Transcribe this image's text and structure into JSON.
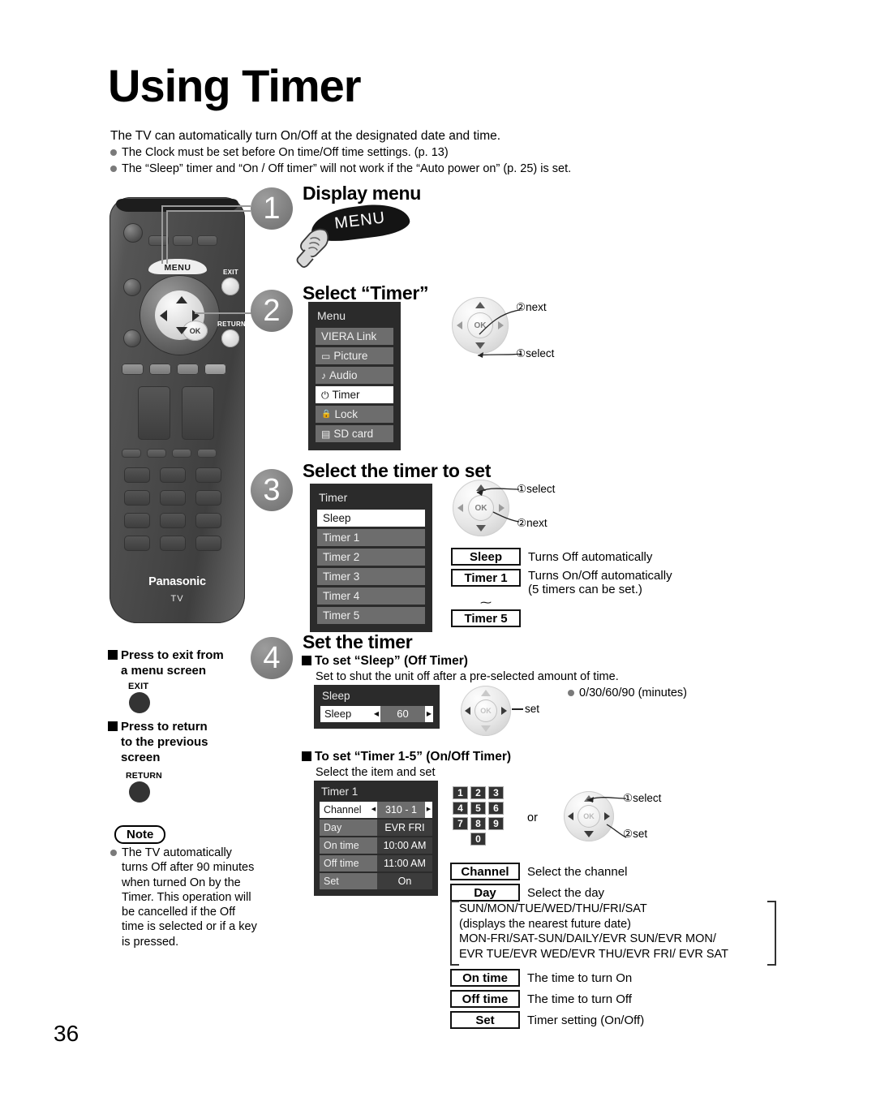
{
  "page": {
    "number": "36",
    "title": "Using Timer"
  },
  "intro": {
    "lead": "The TV can automatically turn On/Off at the designated date and time.",
    "bullets": [
      "The Clock must be set before On time/Off time settings. (p. 13)",
      "The “Sleep” timer and “On / Off timer” will not work if the “Auto power on” (p. 25) is set."
    ]
  },
  "remote": {
    "menu_key_label": "MENU",
    "exit_key_label": "EXIT",
    "return_key_label": "RETURN",
    "ok_label": "OK",
    "brand": "Panasonic",
    "brand_sub": "TV"
  },
  "steps": {
    "one": {
      "num": "1",
      "heading": "Display menu",
      "banner": "MENU"
    },
    "two": {
      "num": "2",
      "heading": "Select “Timer”",
      "menu": {
        "title": "Menu",
        "items": [
          {
            "icon": "",
            "label": "VIERA Link",
            "selected": false
          },
          {
            "icon": "picture-icon",
            "glyph": "▭",
            "label": "Picture",
            "selected": false
          },
          {
            "icon": "audio-note-icon",
            "glyph": "♪",
            "label": "Audio",
            "selected": false
          },
          {
            "icon": "timer-clock-icon",
            "glyph": "⏻",
            "label": "Timer",
            "selected": true
          },
          {
            "icon": "lock-icon",
            "glyph": "🔒",
            "label": "Lock",
            "selected": false
          },
          {
            "icon": "sd-card-icon",
            "glyph": "▤",
            "label": "SD card",
            "selected": false
          }
        ]
      },
      "wheel": {
        "ok": "OK",
        "callout_next": "②next",
        "callout_select": "①select"
      }
    },
    "three": {
      "num": "3",
      "heading": "Select the timer to set",
      "timer_list": {
        "title": "Timer",
        "items": [
          {
            "label": "Sleep",
            "selected": true
          },
          {
            "label": "Timer 1",
            "selected": false
          },
          {
            "label": "Timer 2",
            "selected": false
          },
          {
            "label": "Timer 3",
            "selected": false
          },
          {
            "label": "Timer 4",
            "selected": false
          },
          {
            "label": "Timer 5",
            "selected": false
          }
        ]
      },
      "wheel": {
        "ok": "OK",
        "callout_select": "①select",
        "callout_next": "②next"
      },
      "legend": [
        {
          "key": "Sleep",
          "desc": "Turns Off automatically"
        },
        {
          "key": "Timer 1",
          "desc": "Turns On/Off automatically"
        },
        {
          "key": "",
          "desc": "(5 timers can be set.)"
        },
        {
          "key": "Timer 5",
          "desc": ""
        }
      ],
      "tilde": "⁓"
    },
    "four": {
      "num": "4",
      "heading": "Set the timer",
      "sleep_section": {
        "subheading": "To set “Sleep” (Off Timer)",
        "desc": "Set to shut the unit off after a pre-selected amount of time.",
        "panel": {
          "title": "Sleep",
          "row_label": "Sleep",
          "row_value": "60",
          "arrow_left": "◀",
          "arrow_right": "▶"
        },
        "wheel_label": "set",
        "wheel_ok": "OK",
        "note_bullet": "0/30/60/90 (minutes)"
      },
      "timer_section": {
        "subheading": "To set “Timer 1-5” (On/Off Timer)",
        "desc": "Select the item and set",
        "panel": {
          "title": "Timer 1",
          "rows": [
            {
              "label": "Channel",
              "value": "310 - 1",
              "selected": true,
              "arrows": true
            },
            {
              "label": "Day",
              "value": "EVR FRI",
              "selected": false,
              "arrows": false
            },
            {
              "label": "On time",
              "value": "10:00 AM",
              "selected": false,
              "arrows": false
            },
            {
              "label": "Off time",
              "value": "11:00 AM",
              "selected": false,
              "arrows": false
            },
            {
              "label": "Set",
              "value": "On",
              "selected": false,
              "arrows": false
            }
          ]
        },
        "keypad": [
          "1",
          "2",
          "3",
          "4",
          "5",
          "6",
          "7",
          "8",
          "9",
          "0"
        ],
        "or_label": "or",
        "wheel": {
          "ok": "OK",
          "callout_select": "①select",
          "callout_set": "②set"
        },
        "legend": [
          {
            "key": "Channel",
            "desc": "Select the channel"
          },
          {
            "key": "Day",
            "desc": "Select the day"
          },
          {
            "key": "On time",
            "desc": "The time to turn On"
          },
          {
            "key": "Off time",
            "desc": "The time to turn Off"
          },
          {
            "key": "Set",
            "desc": "Timer setting (On/Off)"
          }
        ],
        "day_options": [
          "SUN/MON/TUE/WED/THU/FRI/SAT",
          "(displays the nearest future date)",
          "MON-FRI/SAT-SUN/DAILY/EVR SUN/EVR MON/",
          "EVR TUE/EVR WED/EVR THU/EVR FRI/ EVR SAT"
        ]
      }
    }
  },
  "side_notes": {
    "exit_block": {
      "line1": "Press to exit from",
      "line2": "a menu screen",
      "key": "EXIT"
    },
    "return_block": {
      "line1": "Press to return",
      "line2": "to the previous",
      "line3": "screen",
      "key": "RETURN"
    },
    "note_caption": "Note",
    "note_text": "The TV automatically turns Off after 90 minutes when turned On by the Timer. This operation will be cancelled if the Off time is selected or if a key is pressed."
  }
}
